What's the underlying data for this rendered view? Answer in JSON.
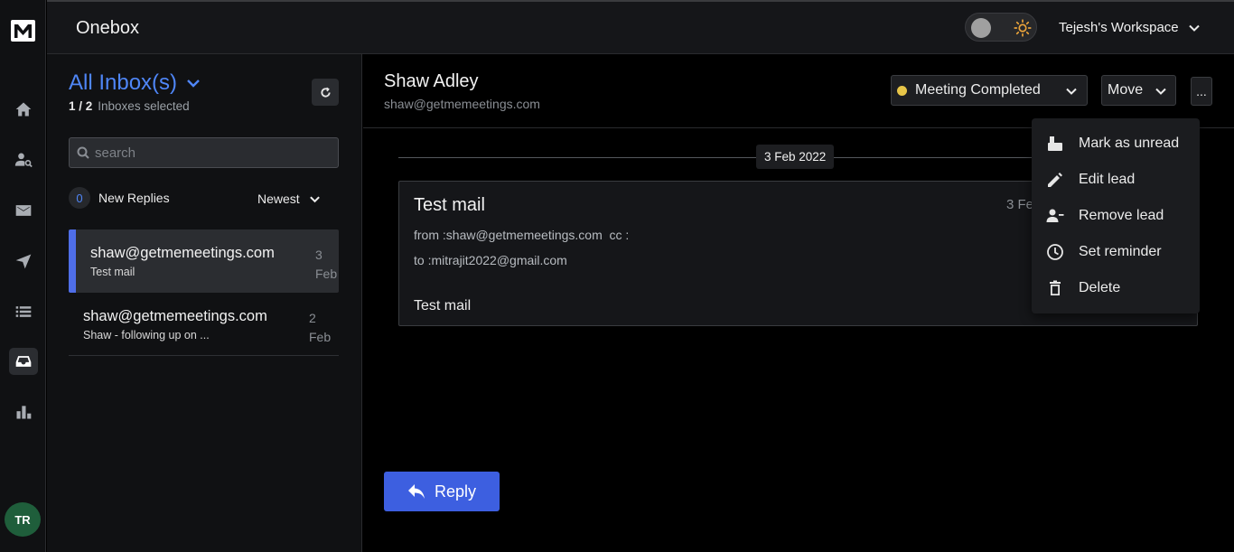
{
  "app": {
    "title": "Onebox",
    "logo": "M",
    "avatar_initials": "TR"
  },
  "header": {
    "workspace_label": "Tejesh's Workspace",
    "theme": "dark"
  },
  "colors": {
    "accent": "#4f86f7",
    "reply_button": "#3d5fe0",
    "status_dot": "#e7c548",
    "avatar_bg": "#1f5e3b"
  },
  "sidebar": {
    "icons": [
      "home-icon",
      "user-search-icon",
      "mail-icon",
      "send-icon",
      "list-icon",
      "inbox-icon",
      "bar-chart-icon"
    ],
    "active": "inbox-icon"
  },
  "inbox": {
    "title": "All Inbox(s)",
    "selected_count": "1 / 2",
    "selected_label": "Inboxes selected",
    "search_placeholder": "search",
    "new_replies_count": "0",
    "new_replies_label": "New Replies",
    "sort_label": "Newest",
    "threads": [
      {
        "from": "shaw@getmemeetings.com",
        "snippet": "Test mail",
        "date_day": "3",
        "date_month": "Feb",
        "selected": true
      },
      {
        "from": "shaw@getmemeetings.com",
        "snippet": "Shaw - following up on ...",
        "date_day": "2",
        "date_month": "Feb",
        "selected": false
      }
    ]
  },
  "detail": {
    "lead_name": "Shaw Adley",
    "lead_email": "shaw@getmemeetings.com",
    "status_label": "Meeting Completed",
    "move_label": "Move",
    "more_label": "...",
    "date_divider": "3 Feb 2022",
    "mail": {
      "subject": "Test mail",
      "date": "3 Fe",
      "from_line": "from :shaw@getmemeetings.com  cc :",
      "to_line": "to :mitrajit2022@gmail.com",
      "body": "Test mail"
    },
    "reply_label": "Reply"
  },
  "menu": {
    "items": [
      {
        "label": "Mark as unread",
        "icon": "mark-unread-icon"
      },
      {
        "label": "Edit lead",
        "icon": "pencil-icon"
      },
      {
        "label": "Remove lead",
        "icon": "remove-user-icon"
      },
      {
        "label": "Set reminder",
        "icon": "clock-icon"
      },
      {
        "label": "Delete",
        "icon": "trash-icon"
      }
    ]
  }
}
